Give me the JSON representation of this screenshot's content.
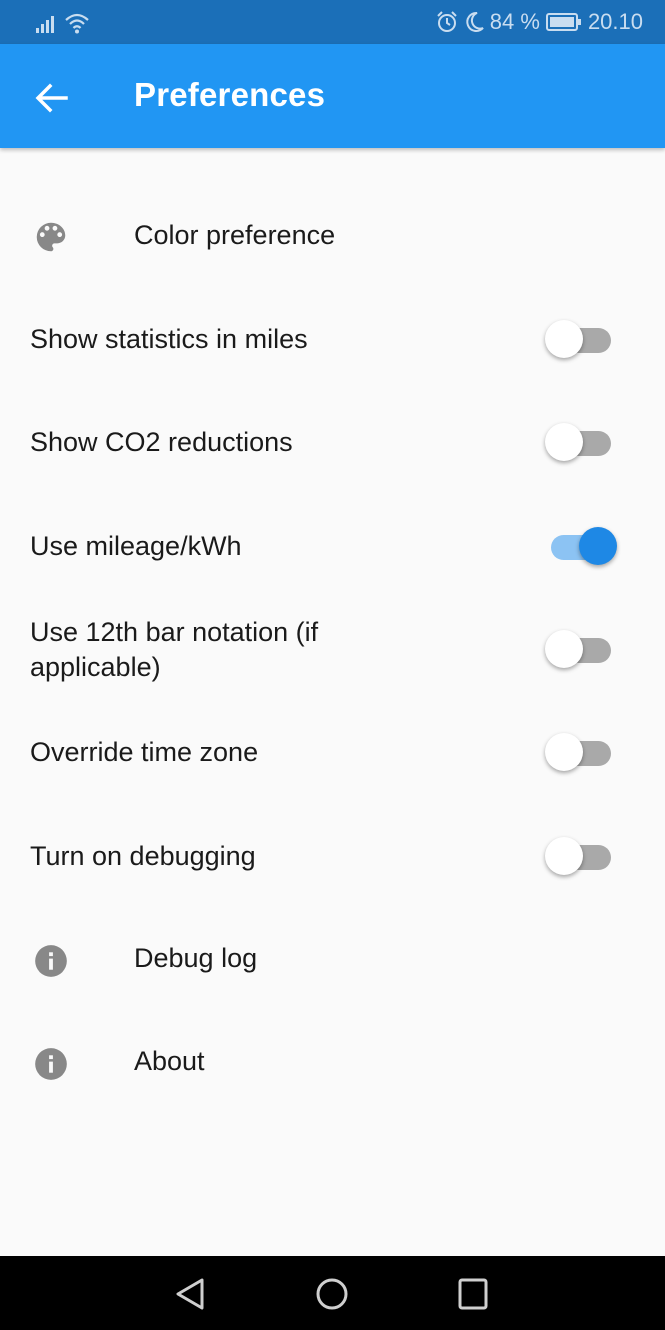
{
  "status_bar": {
    "battery_percent": "84 %",
    "time": "20.10",
    "icons": [
      "signal-icon",
      "wifi-icon",
      "alarm-icon",
      "moon-icon",
      "battery-icon"
    ]
  },
  "app_bar": {
    "title": "Preferences",
    "back_icon": "arrow-left-icon"
  },
  "settings": [
    {
      "type": "link",
      "icon": "palette-icon",
      "label": "Color preference"
    },
    {
      "type": "switch",
      "label": "Show statistics in miles",
      "on": false
    },
    {
      "type": "switch",
      "label": "Show CO2 reductions",
      "on": false
    },
    {
      "type": "switch",
      "label": "Use mileage/kWh",
      "on": true
    },
    {
      "type": "switch",
      "label": "Use 12th bar notation (if applicable)",
      "on": false
    },
    {
      "type": "switch",
      "label": "Override time zone",
      "on": false
    },
    {
      "type": "switch",
      "label": "Turn on debugging",
      "on": false
    },
    {
      "type": "link",
      "icon": "info-icon",
      "label": "Debug log"
    },
    {
      "type": "link",
      "icon": "info-icon",
      "label": "About"
    }
  ],
  "nav_bar": {
    "buttons": [
      "back-triangle-icon",
      "home-circle-icon",
      "recents-square-icon"
    ]
  },
  "colors": {
    "primary": "#2196f3",
    "status_bar": "#1b6fb8",
    "switch_on": "#1e88e5",
    "switch_track_on": "#8cc3f3",
    "switch_track_off": "#a9a9a9"
  }
}
